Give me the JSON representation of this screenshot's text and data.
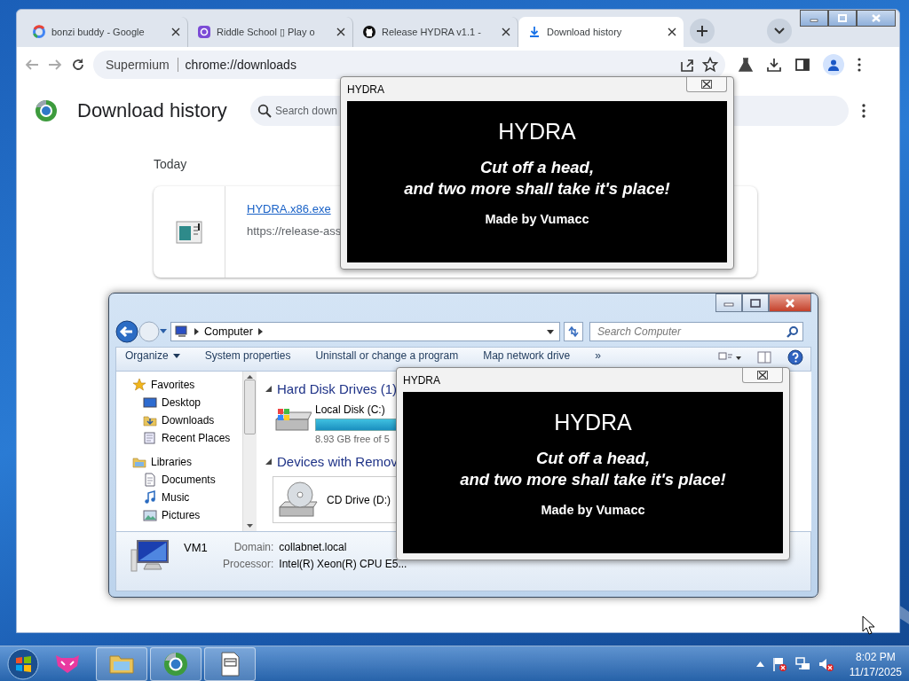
{
  "browser": {
    "tabs": [
      {
        "title": "bonzi buddy - Google",
        "selected": false
      },
      {
        "title": "Riddle School ▯ Play o",
        "selected": false
      },
      {
        "title": "Release HYDRA v1.1 -",
        "selected": false
      },
      {
        "title": "Download history",
        "selected": true
      }
    ],
    "address": {
      "site_label": "Supermium",
      "url": "chrome://downloads"
    },
    "page": {
      "title": "Download history",
      "search_placeholder": "Search down",
      "group_label": "Today",
      "downloads": [
        {
          "file_name": "HYDRA.x86.exe",
          "source": "https://release-ass"
        }
      ]
    }
  },
  "explorer": {
    "breadcrumb": [
      "Computer"
    ],
    "search_placeholder": "Search Computer",
    "commands": [
      "Organize",
      "System properties",
      "Uninstall or change a program",
      "Map network drive",
      "»"
    ],
    "nav": [
      {
        "label": "Favorites",
        "children": [
          {
            "label": "Desktop"
          },
          {
            "label": "Downloads"
          },
          {
            "label": "Recent Places"
          }
        ]
      },
      {
        "label": "Libraries",
        "children": [
          {
            "label": "Documents"
          },
          {
            "label": "Music"
          },
          {
            "label": "Pictures"
          }
        ]
      }
    ],
    "groups": [
      {
        "title": "Hard Disk Drives (1)",
        "items": [
          {
            "kind": "disk",
            "name": "Local Disk (C:)",
            "detail": "8.93 GB free of 5"
          }
        ]
      },
      {
        "title": "Devices with Remov",
        "items": [
          {
            "kind": "cd",
            "name": "CD Drive (D:)"
          }
        ]
      }
    ],
    "details": {
      "computer_name": "VM1",
      "fields": [
        {
          "label": "Domain:",
          "value": "collabnet.local"
        },
        {
          "label": "Processor:",
          "value": "Intel(R) Xeon(R) CPU E5..."
        }
      ]
    }
  },
  "popups": [
    {
      "title": "HYDRA",
      "heading": "HYDRA",
      "lines": [
        "Cut off a head,",
        "and two more shall take it's place!"
      ],
      "credit": "Made by Vumacc"
    },
    {
      "title": "HYDRA",
      "heading": "HYDRA",
      "lines": [
        "Cut off a head,",
        "and two more shall take it's place!"
      ],
      "credit": "Made by Vumacc"
    }
  ],
  "taskbar": {
    "apps": [
      {
        "kind": "cat",
        "running": false
      },
      {
        "kind": "folder",
        "running": true
      },
      {
        "kind": "globe",
        "running": true
      },
      {
        "kind": "document",
        "running": true
      }
    ],
    "time": "8:02 PM",
    "date": "11/17/2025"
  }
}
